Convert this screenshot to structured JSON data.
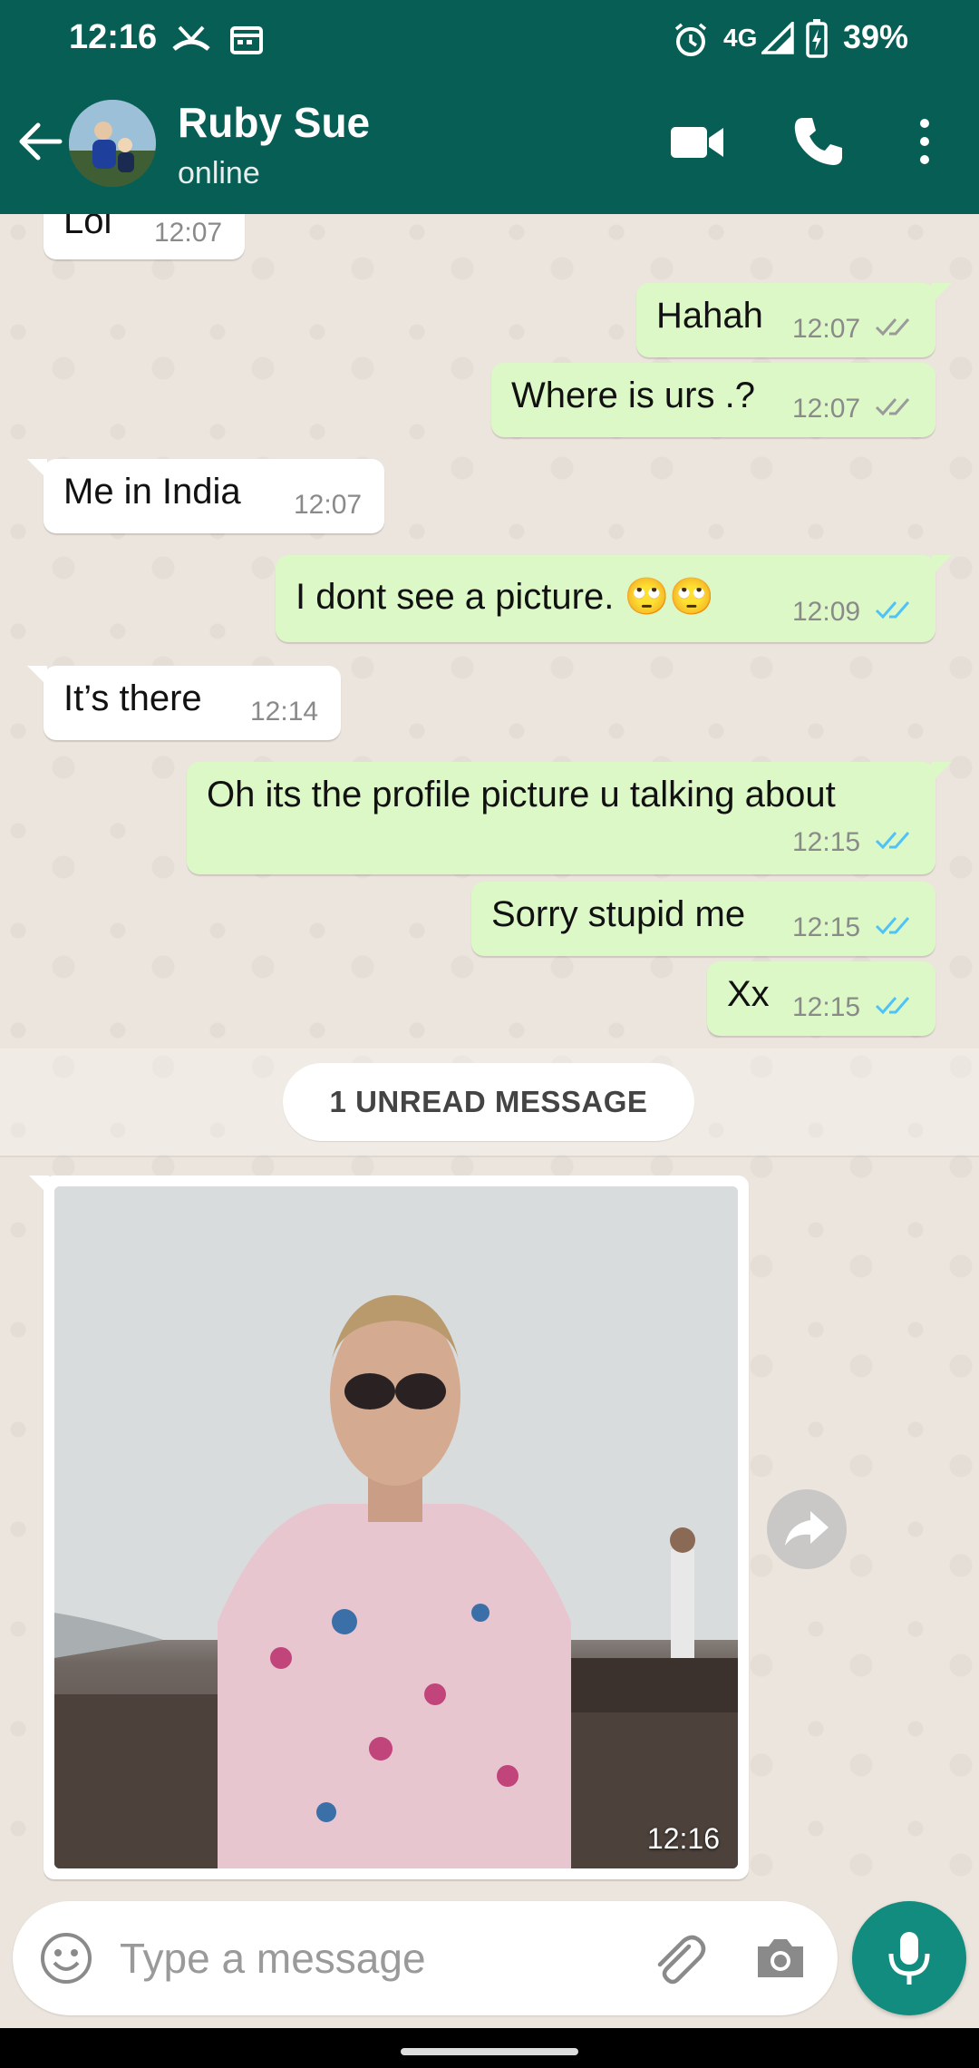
{
  "status_bar": {
    "time": "12:16",
    "network": "4G",
    "battery": "39%"
  },
  "header": {
    "contact_name": "Ruby Sue",
    "contact_status": "online",
    "colors": {
      "bar": "#075E54"
    }
  },
  "messages": [
    {
      "text": "Lol",
      "time": "12:07",
      "direction": "incoming"
    },
    {
      "text": "Hahah",
      "time": "12:07",
      "direction": "outgoing",
      "ticks": "delivered"
    },
    {
      "text": "Where is urs .?",
      "time": "12:07",
      "direction": "outgoing",
      "ticks": "delivered"
    },
    {
      "text": "Me in India",
      "time": "12:07",
      "direction": "incoming"
    },
    {
      "text": "I dont see a picture. 🙄🙄",
      "time": "12:09",
      "direction": "outgoing",
      "ticks": "read"
    },
    {
      "text": "It’s there",
      "time": "12:14",
      "direction": "incoming"
    },
    {
      "text": "Oh its the profile  picture u talking about",
      "time": "12:15",
      "direction": "outgoing",
      "ticks": "read"
    },
    {
      "text": "Sorry stupid me",
      "time": "12:15",
      "direction": "outgoing",
      "ticks": "read"
    },
    {
      "text": "Xx",
      "time": "12:15",
      "direction": "outgoing",
      "ticks": "read"
    }
  ],
  "unread_banner": "1 UNREAD MESSAGE",
  "photo_message": {
    "time": "12:16",
    "direction": "incoming"
  },
  "composer": {
    "placeholder": "Type a message"
  },
  "icons": {
    "back": "arrow-left-icon",
    "video": "video-camera-icon",
    "call": "phone-icon",
    "menu": "more-vert-icon",
    "emoji": "emoji-icon",
    "attach": "paperclip-icon",
    "camera": "camera-icon",
    "mic": "microphone-icon",
    "forward": "forward-icon"
  },
  "colors": {
    "outgoing_bubble": "#DCF8C6",
    "incoming_bubble": "#FFFFFF",
    "read_tick": "#4FC3F7",
    "accent": "#128C7E"
  }
}
